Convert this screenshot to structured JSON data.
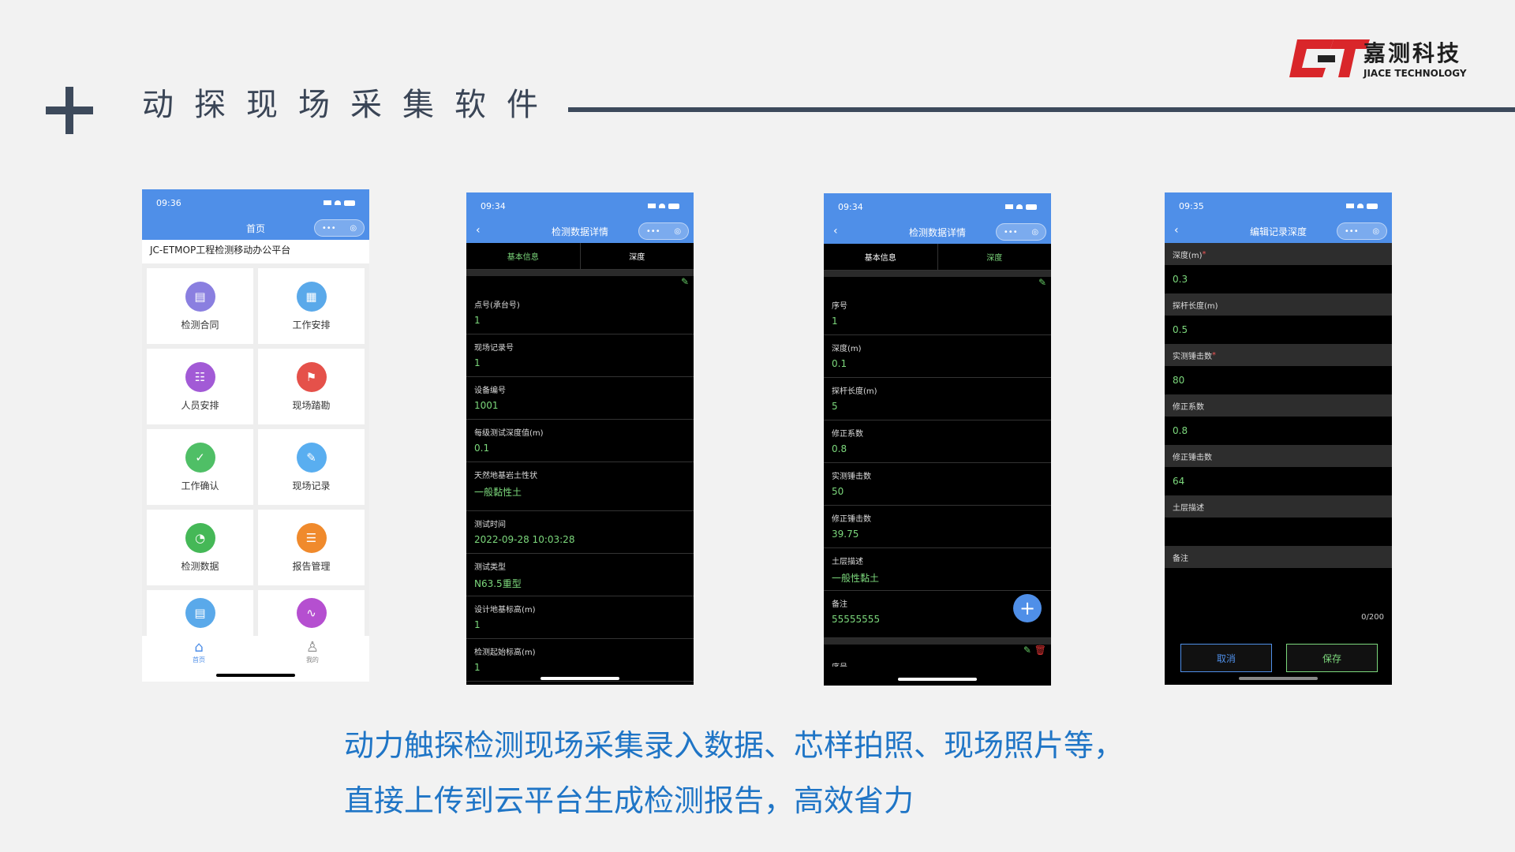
{
  "header": {
    "title": "动探现场采集软件",
    "logo_cn": "嘉测科技",
    "logo_en": "JIACE TECHNOLOGY"
  },
  "colors": {
    "accent_blue": "#4f8fe8",
    "value_green": "#7cd87c",
    "logo_red": "#d9262a"
  },
  "phone1": {
    "time": "09:36",
    "nav_title": "首页",
    "subtitle": "JC-ETMOP工程检测移动办公平台",
    "items": [
      "检测合同",
      "工作安排",
      "人员安排",
      "现场踏勘",
      "工作确认",
      "现场记录",
      "检测数据",
      "报告管理"
    ],
    "tabbar": [
      "首页",
      "我的"
    ]
  },
  "phone2": {
    "time": "09:34",
    "nav_title": "检测数据详情",
    "tabs": [
      "基本信息",
      "深度"
    ],
    "fields": [
      {
        "k": "点号(承台号)",
        "v": "1"
      },
      {
        "k": "现场记录号",
        "v": "1"
      },
      {
        "k": "设备编号",
        "v": "1001"
      },
      {
        "k": "每级测试深度值(m)",
        "v": "0.1"
      },
      {
        "k": "天然地基岩土性状",
        "v": "一般黏性土"
      },
      {
        "k": "测试时间",
        "v": "2022-09-28 10:03:28"
      },
      {
        "k": "测试类型",
        "v": "N63.5重型"
      },
      {
        "k": "设计地基标高(m)",
        "v": "1"
      },
      {
        "k": "检测起始标高(m)",
        "v": "1"
      }
    ]
  },
  "phone3": {
    "time": "09:34",
    "nav_title": "检测数据详情",
    "tabs": [
      "基本信息",
      "深度"
    ],
    "fields": [
      {
        "k": "序号",
        "v": "1"
      },
      {
        "k": "深度(m)",
        "v": "0.1"
      },
      {
        "k": "探杆长度(m)",
        "v": "5"
      },
      {
        "k": "修正系数",
        "v": "0.8"
      },
      {
        "k": "实测锤击数",
        "v": "50"
      },
      {
        "k": "修正锤击数",
        "v": "39.75"
      },
      {
        "k": "土层描述",
        "v": "一般性黏土"
      },
      {
        "k": "备注",
        "v": "55555555"
      }
    ],
    "next_label": "序号"
  },
  "phone4": {
    "time": "09:35",
    "nav_title": "编辑记录深度",
    "fields": [
      {
        "k": "深度(m)",
        "v": "0.3"
      },
      {
        "k": "探杆长度(m)",
        "v": "0.5"
      },
      {
        "k": "实测锤击数",
        "v": "80"
      },
      {
        "k": "修正系数",
        "v": "0.8"
      },
      {
        "k": "修正锤击数",
        "v": "64"
      },
      {
        "k": "土层描述",
        "v": ""
      }
    ],
    "remark_label": "备注",
    "counter": "0/200",
    "cancel": "取消",
    "save": "保存"
  },
  "caption": {
    "line1": "动力触探检测现场采集录入数据、芯样拍照、现场照片等，",
    "line2": "直接上传到云平台生成检测报告，高效省力"
  }
}
